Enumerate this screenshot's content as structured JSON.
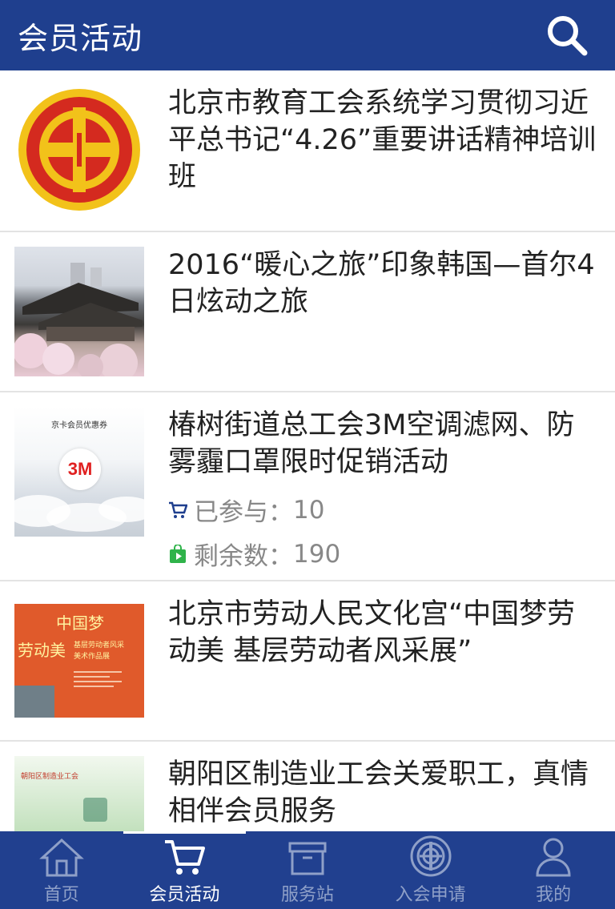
{
  "header": {
    "title": "会员活动",
    "search_icon": "search-icon"
  },
  "items": [
    {
      "title": "北京市教育工会系统学习贯彻习近平总书记“4.26”重要讲话精神培训班",
      "thumb": "union-logo"
    },
    {
      "title": "2016“暖心之旅”印象韩国—首尔4日炫动之旅",
      "thumb": "korea-photo"
    },
    {
      "title": "椿树街道总工会3M空调滤网、防雾霾口罩限时促销活动",
      "thumb": "3m-promo",
      "thumb_text": "京卡会员优惠券",
      "thumb_logo": "3M",
      "joined_label": "已参与：",
      "joined_value": "10",
      "remaining_label": "剩余数：",
      "remaining_value": "190"
    },
    {
      "title": "北京市劳动人民文化宫“中国梦劳动美 基层劳动者风采展”",
      "thumb": "exhibition-poster",
      "thumb_text_1": "中国梦",
      "thumb_text_2": "劳动美",
      "thumb_text_3": "基层劳动者风采",
      "thumb_text_4": "美术作品展"
    },
    {
      "title": "朝阳区制造业工会关爱职工，真情相伴会员服务",
      "thumb": "green-banner",
      "thumb_text": "朝阳区制造业工会"
    }
  ],
  "tabs": [
    {
      "label": "首页",
      "icon": "home-icon"
    },
    {
      "label": "会员活动",
      "icon": "cart-icon",
      "active": true
    },
    {
      "label": "服务站",
      "icon": "box-icon"
    },
    {
      "label": "入会申请",
      "icon": "union-icon"
    },
    {
      "label": "我的",
      "icon": "person-icon"
    }
  ],
  "colors": {
    "header_bg": "#1f3f8e",
    "tabbar_bg": "#21408f",
    "logo_red": "#d42a1f",
    "logo_gold": "#f2c21a"
  }
}
